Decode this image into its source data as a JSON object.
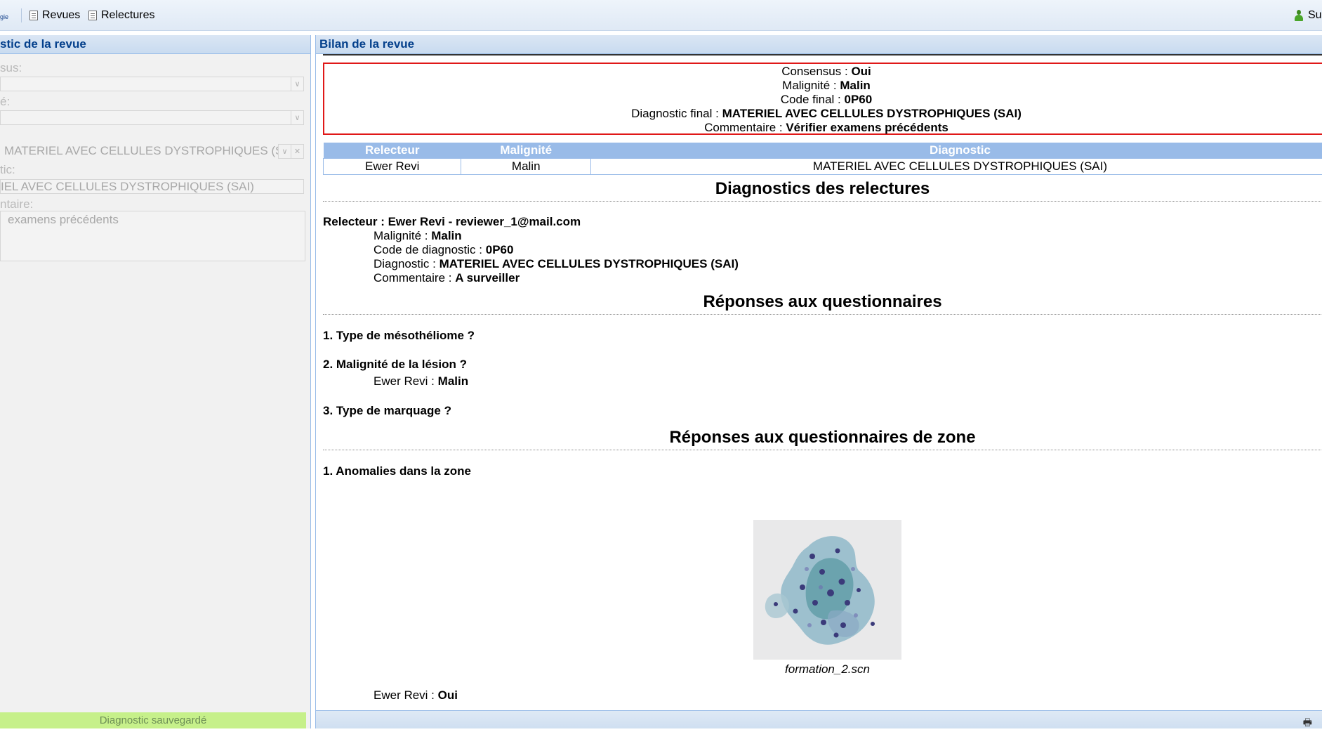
{
  "toolbar": {
    "left_partial": "gie",
    "revues_label": "Revues",
    "relectures_label": "Relectures",
    "user_partial": "Sup"
  },
  "left_panel": {
    "title": "stic de la revue",
    "label_1": "sus:",
    "label_2": "é:",
    "combo_diag_value": "MATERIEL AVEC CELLULES DYSTROPHIQUES (SAI)",
    "label_3": "tic:",
    "diag_text": "IEL AVEC CELLULES DYSTROPHIQUES (SAI)",
    "label_4": "ntaire:",
    "comment_text": "examens précédents",
    "status": "Diagnostic sauvegardé"
  },
  "right_panel": {
    "title": "Bilan de la revue",
    "summary": {
      "consensus_label": "Consensus :",
      "consensus_value": "Oui",
      "malignite_label": "Malignité :",
      "malignite_value": "Malin",
      "code_label": "Code final :",
      "code_value": "0P60",
      "diag_label": "Diagnostic final :",
      "diag_value": "MATERIEL AVEC CELLULES DYSTROPHIQUES (SAI)",
      "comment_label": "Commentaire :",
      "comment_value": "Vérifier examens précédents"
    },
    "table": {
      "headers": [
        "Relecteur",
        "Malignité",
        "Diagnostic"
      ],
      "rows": [
        [
          "Ewer Revi",
          "Malin",
          "MATERIEL AVEC CELLULES DYSTROPHIQUES (SAI)"
        ]
      ]
    },
    "section_diagnostics": "Diagnostics des relectures",
    "reviewer": {
      "header": "Relecteur : Ewer Revi - reviewer_1@mail.com",
      "malignite_label": "Malignité :",
      "malignite_value": "Malin",
      "code_label": "Code de diagnostic :",
      "code_value": "0P60",
      "diag_label": "Diagnostic :",
      "diag_value": "MATERIEL AVEC CELLULES DYSTROPHIQUES (SAI)",
      "comment_label": "Commentaire :",
      "comment_value": "A surveiller"
    },
    "section_questionnaires": "Réponses aux questionnaires",
    "q1": "1. Type de mésothéliome ?",
    "q2": "2. Malignité de la lésion ?",
    "q2_answer_name": "Ewer Revi :",
    "q2_answer_value": "Malin",
    "q3": "3. Type de marquage ?",
    "section_zone": "Réponses aux questionnaires de zone",
    "z1": "1. Anomalies dans la zone",
    "image_caption": "formation_2.scn",
    "z1_answer_name": "Ewer Revi :",
    "z1_answer_value": "Oui"
  }
}
